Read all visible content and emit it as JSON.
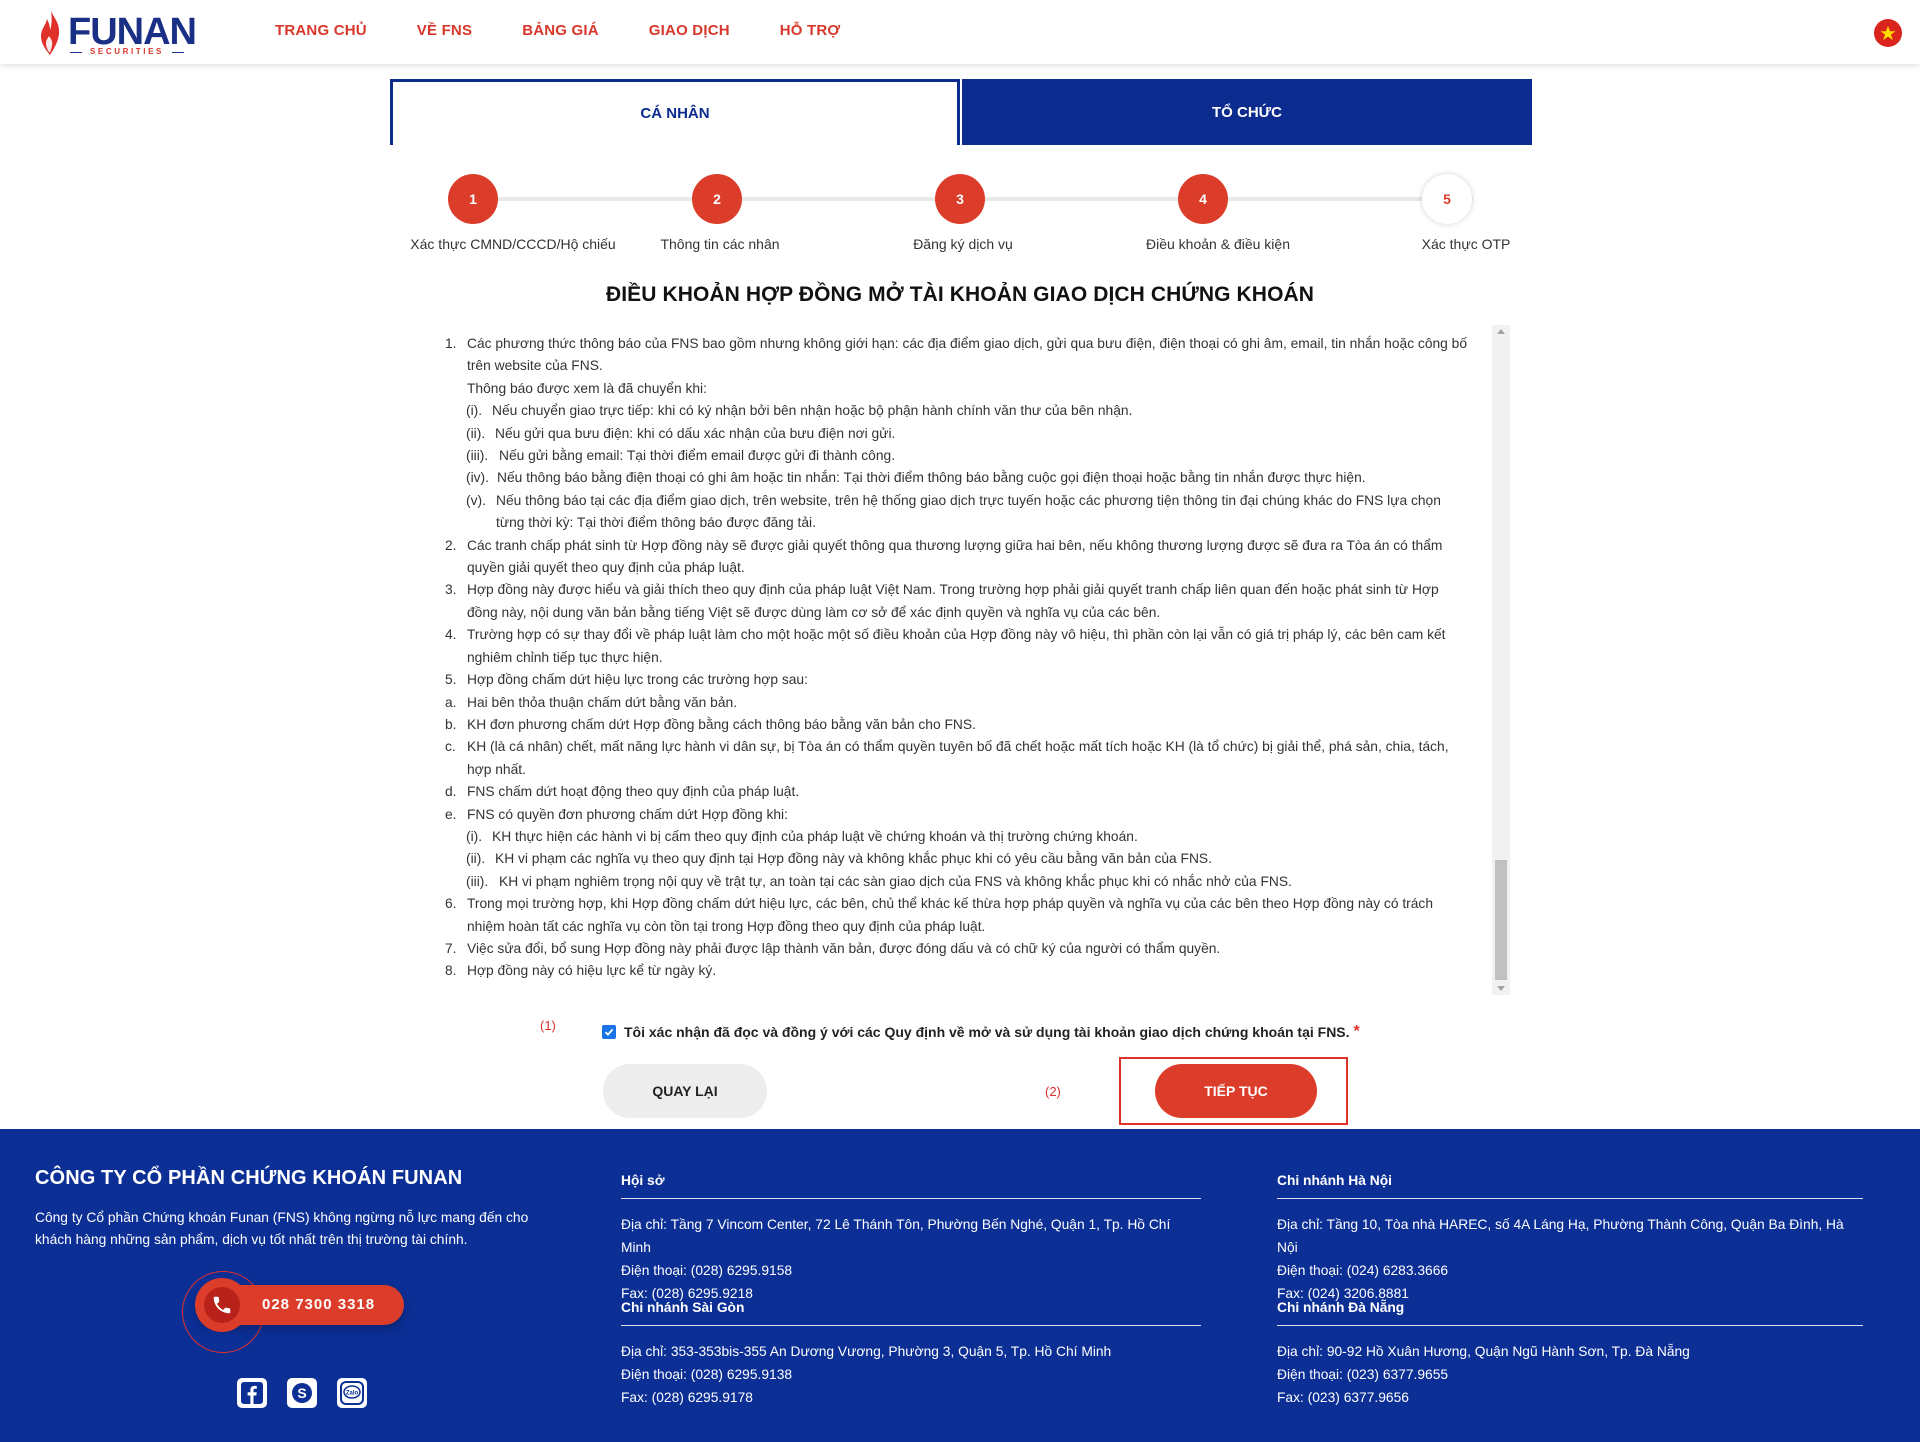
{
  "header": {
    "brand": "FUNAN",
    "brand_sub": "SECURITIES",
    "nav": [
      "TRANG CHỦ",
      "VỀ FNS",
      "BẢNG GIÁ",
      "GIAO DỊCH",
      "HỖ TRỢ"
    ]
  },
  "tabs": {
    "individual": "CÁ NHÂN",
    "organization": "TỔ CHỨC"
  },
  "steps": [
    {
      "num": "1",
      "label": "Xác thực CMND/CCCD/Hộ chiếu",
      "state": "done"
    },
    {
      "num": "2",
      "label": "Thông tin các nhân",
      "state": "done"
    },
    {
      "num": "3",
      "label": "Đăng ký dịch vụ",
      "state": "done"
    },
    {
      "num": "4",
      "label": "Điều khoản & điều kiện",
      "state": "active"
    },
    {
      "num": "5",
      "label": "Xác thực OTP",
      "state": "pending"
    }
  ],
  "title": "ĐIỀU KHOẢN HỢP ĐỒNG MỞ TÀI KHOẢN GIAO DỊCH CHỨNG KHOÁN",
  "terms": {
    "i1": "Các phương thức thông báo của FNS bao gồm nhưng không giới hạn: các địa điểm giao dịch, gửi qua bưu điện, điện thoại có ghi âm, email, tin nhắn hoặc công bố trên website của FNS.",
    "i1b": "Thông báo được xem là đã chuyển khi:",
    "i1_i": "Nếu chuyển giao trực tiếp: khi có ký nhận bởi bên nhận hoặc bộ phận hành chính văn thư của bên nhận.",
    "i1_ii": "Nếu gửi qua bưu điện: khi có dấu xác nhận của bưu điện nơi gửi.",
    "i1_iii": "Nếu gửi bằng email: Tại thời điểm email được gửi đi thành công.",
    "i1_iv": "Nếu thông báo bằng điện thoại có ghi âm hoặc tin nhắn: Tại thời điểm thông báo bằng cuộc gọi điện thoại hoặc bằng tin nhắn được thực hiện.",
    "i1_v": "Nếu thông báo tại các địa điểm giao dịch, trên website, trên hệ thống giao dịch trực tuyến hoặc các phương tiện thông tin đại chúng khác do FNS lựa chọn từng thời kỳ: Tại thời điểm thông báo được đăng tải.",
    "i2": "Các tranh chấp phát sinh từ Hợp đồng này sẽ được giải quyết thông qua thương lượng giữa hai bên, nếu không thương lượng được sẽ đưa ra Tòa án có thẩm quyền giải quyết theo quy định của pháp luật.",
    "i3": "Hợp đồng này được hiểu và giải thích theo quy định của pháp luật Việt Nam. Trong trường hợp phải giải quyết tranh chấp liên quan đến hoặc phát sinh từ Hợp đồng này, nội dung văn bản bằng tiếng Việt sẽ được dùng làm cơ sở để xác định quyền và nghĩa vụ của các bên.",
    "i4": "Trường hợp có sự thay đổi về pháp luật làm cho một hoặc một số điều khoản của Hợp đồng này vô hiệu, thì phần còn lại vẫn có giá trị pháp lý, các bên cam kết nghiêm chỉnh tiếp tục thực hiện.",
    "i5": "Hợp đồng chấm dứt hiệu lực trong các trường hợp sau:",
    "i5a": "Hai bên thỏa thuận chấm dứt bằng văn bản.",
    "i5b": "KH đơn phương chấm dứt Hợp đồng bằng cách thông báo bằng văn bản cho FNS.",
    "i5c": "KH (là cá nhân) chết, mất năng lực hành vi dân sự, bị Tòa án có thẩm quyền tuyên bố đã chết hoặc mất tích hoặc KH (là tổ chức) bị giải thể, phá sản, chia, tách, hợp nhất.",
    "i5d": "FNS chấm dứt hoạt động theo quy định của pháp luật.",
    "i5e": "FNS có quyền đơn phương chấm dứt Hợp đồng khi:",
    "i5e_i": "KH thực hiện các hành vi bị cấm theo quy định của pháp luật về chứng khoán và thị trường chứng khoán.",
    "i5e_ii": "KH vi phạm các nghĩa vụ theo quy định tại Hợp đồng này và không khắc phục khi có yêu cầu bằng văn bản của FNS.",
    "i5e_iii": "KH vi phạm nghiêm trọng nội quy về trật tự, an toàn tại các sàn giao dịch của FNS và không khắc phục khi có nhắc nhở của FNS.",
    "i6": "Trong mọi trường hợp, khi Hợp đồng chấm dứt hiệu lực, các bên, chủ thể khác kế thừa hợp pháp quyền và nghĩa vụ của các bên theo Hợp đồng này có trách nhiệm hoàn tất các nghĩa vụ còn tồn tại trong Hợp đồng theo quy định của pháp luật.",
    "i7": "Việc sửa đổi, bổ sung Hợp đồng này phải được lập thành văn bản, được đóng dấu và có chữ ký của người có thẩm quyền.",
    "i8": "Hợp đồng này có hiệu lực kể từ ngày ký."
  },
  "annotations": {
    "a1": "(1)",
    "a2": "(2)"
  },
  "agree": {
    "text": "Tôi xác nhận đã đọc và đồng ý với các Quy định về mở và sử dụng tài khoản giao dịch chứng khoán tại FNS.",
    "required": "*",
    "checked": true
  },
  "buttons": {
    "back": "QUAY LẠI",
    "next": "TIẾP TỤC"
  },
  "footer": {
    "company": "CÔNG TY CỔ PHẦN CHỨNG KHOÁN FUNAN",
    "desc": "Công ty Cổ phần Chứng khoán Funan (FNS) không ngừng nỗ lực mang đến cho khách hàng những sản phẩm, dịch vụ tốt nhất trên thị trường tài chính.",
    "hotline": "028 7300 3318",
    "offices": {
      "hq": {
        "title": "Hội sở",
        "address": "Địa chỉ: Tầng 7 Vincom Center, 72 Lê Thánh Tôn, Phường Bến Nghé, Quận 1, Tp. Hồ Chí Minh",
        "phone": "Điện thoại: (028) 6295.9158",
        "fax": "Fax: (028) 6295.9218"
      },
      "hanoi": {
        "title": "Chi nhánh Hà Nội",
        "address": "Địa chỉ: Tầng 10, Tòa nhà HAREC, số 4A Láng Hạ, Phường Thành Công, Quận Ba Đình, Hà Nội",
        "phone": "Điện thoại: (024) 6283.3666",
        "fax": "Fax: (024) 3206.8881"
      },
      "saigon": {
        "title": "Chi nhánh Sài Gòn",
        "address": "Địa chỉ: 353-353bis-355 An Dương Vương, Phường 3, Quận 5, Tp. Hồ Chí Minh",
        "phone": "Điện thoại: (028) 6295.9138",
        "fax": "Fax: (028) 6295.9178"
      },
      "danang": {
        "title": "Chi nhánh Đà Nẵng",
        "address": "Địa chỉ: 90-92 Hồ Xuân Hương, Quận Ngũ Hành Sơn, Tp. Đà Nẵng",
        "phone": "Điện thoại: (023) 6377.9655",
        "fax": "Fax: (023) 6377.9656"
      }
    }
  },
  "colors": {
    "brand_blue": "#0c2f96",
    "brand_red": "#dc3d2a"
  },
  "icons": [
    "phone-icon",
    "facebook-icon",
    "skype-icon",
    "zalo-icon",
    "vietnam-flag-icon"
  ]
}
